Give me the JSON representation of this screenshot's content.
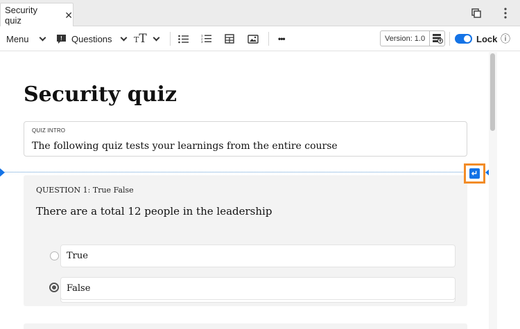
{
  "tab": {
    "title": "Security quiz",
    "close_glyph": "✕"
  },
  "window_icons": {
    "copy": "copy-icon",
    "more": "more-vertical-icon"
  },
  "toolbar": {
    "menu_label": "Menu",
    "questions_label": "Questions",
    "text_glyph": "T",
    "more_glyph": "•••",
    "version_label": "Version: 1.0",
    "lock_label": "Lock",
    "lock_on": true,
    "info_glyph": "ⓘ"
  },
  "document": {
    "title": "Security quiz",
    "intro_label": "QUIZ INTRO",
    "intro_text": "The following quiz tests your learnings from the entire course"
  },
  "question": {
    "label": "QUESTION 1: True False",
    "text": "There are a total 12 people in the leadership",
    "options": [
      {
        "label": "True",
        "selected": false
      },
      {
        "label": "False",
        "selected": true
      }
    ]
  },
  "colors": {
    "accent": "#1473e6",
    "highlight": "#f28c28"
  },
  "enter_glyph": "↵"
}
